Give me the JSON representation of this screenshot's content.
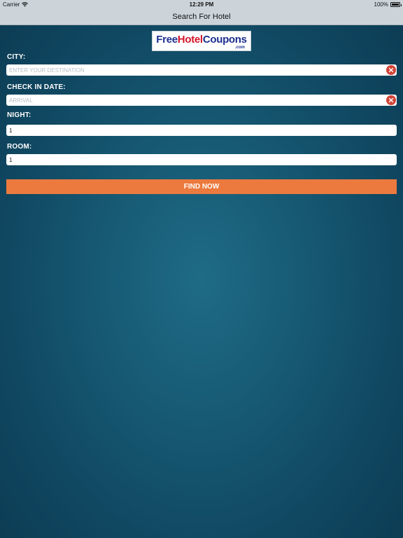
{
  "status_bar": {
    "carrier": "Carrier",
    "time": "12:29 PM",
    "battery": "100%"
  },
  "nav": {
    "title": "Search For Hotel"
  },
  "logo": {
    "part1": "Free",
    "part2": "Hotel",
    "part3": "Coupons",
    "suffix": ".com"
  },
  "form": {
    "city": {
      "label": "CITY:",
      "placeholder": "ENTER YOUR DESTINATION",
      "value": ""
    },
    "checkin": {
      "label": "CHECK IN DATE:",
      "placeholder": "ARRIVAL",
      "value": ""
    },
    "night": {
      "label": "NIGHT:",
      "value": "1"
    },
    "room": {
      "label": "ROOM:",
      "value": "1"
    },
    "submit_label": "FIND NOW"
  },
  "icons": {
    "wifi": "wifi-icon",
    "battery": "battery-icon",
    "clear": "clear-icon"
  },
  "colors": {
    "accent": "#ec7a3e",
    "clear": "#d24437",
    "background": "#175a74"
  }
}
